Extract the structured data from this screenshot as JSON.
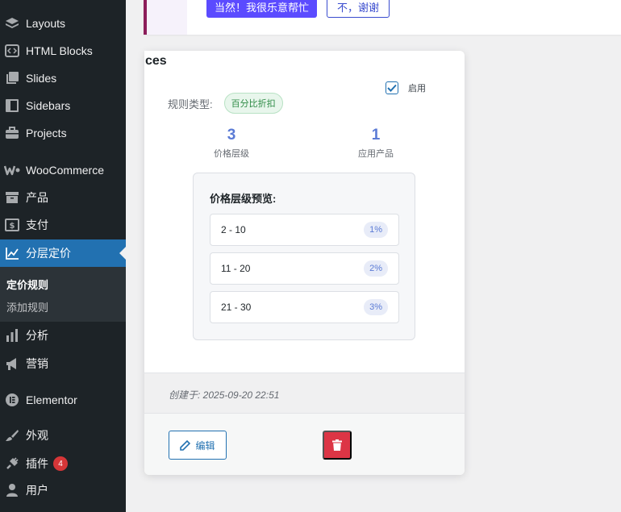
{
  "sidebar": {
    "items": [
      {
        "label": "Layouts",
        "icon": "layers-icon"
      },
      {
        "label": "HTML Blocks",
        "icon": "code-icon"
      },
      {
        "label": "Slides",
        "icon": "slides-icon"
      },
      {
        "label": "Sidebars",
        "icon": "sidebar-icon"
      },
      {
        "label": "Projects",
        "icon": "briefcase-icon"
      },
      {
        "label": "WooCommerce",
        "icon": "woocommerce-icon"
      },
      {
        "label": "产品",
        "icon": "archive-icon"
      },
      {
        "label": "支付",
        "icon": "dollar-icon"
      },
      {
        "label": "分层定价",
        "icon": "chart-line-icon"
      },
      {
        "label": "分析",
        "icon": "bar-chart-icon"
      },
      {
        "label": "营销",
        "icon": "megaphone-icon"
      },
      {
        "label": "Elementor",
        "icon": "elementor-icon"
      },
      {
        "label": "外观",
        "icon": "brush-icon"
      },
      {
        "label": "插件",
        "icon": "plugin-icon",
        "badge": "4"
      },
      {
        "label": "用户",
        "icon": "user-icon"
      }
    ],
    "submenu": [
      {
        "label": "定价规则"
      },
      {
        "label": "添加规则"
      }
    ]
  },
  "notice": {
    "primary_label": "当然！我很乐意帮忙",
    "secondary_label": "不，谢谢"
  },
  "card": {
    "title_fragment": "ces",
    "enable_label": "启用",
    "enabled": true,
    "rule_type_label": "规则类型:",
    "rule_type_value": "百分比折扣",
    "stats": [
      {
        "value": "3",
        "label": "价格层级"
      },
      {
        "value": "1",
        "label": "应用产品"
      }
    ],
    "preview_title": "价格层级预览:",
    "tiers": [
      {
        "range": "2 - 10",
        "percent": "1%"
      },
      {
        "range": "11 - 20",
        "percent": "2%"
      },
      {
        "range": "21 - 30",
        "percent": "3%"
      }
    ],
    "created": "创建于: 2025-09-20 22:51",
    "edit_label": "编辑"
  },
  "colors": {
    "sidebar_bg": "#1d2327",
    "active_bg": "#2271b1",
    "accent_blue": "#5b7bd5",
    "delete_red": "#dc3545",
    "badge_red": "#d63638",
    "primary_btn": "#5b4bff"
  }
}
